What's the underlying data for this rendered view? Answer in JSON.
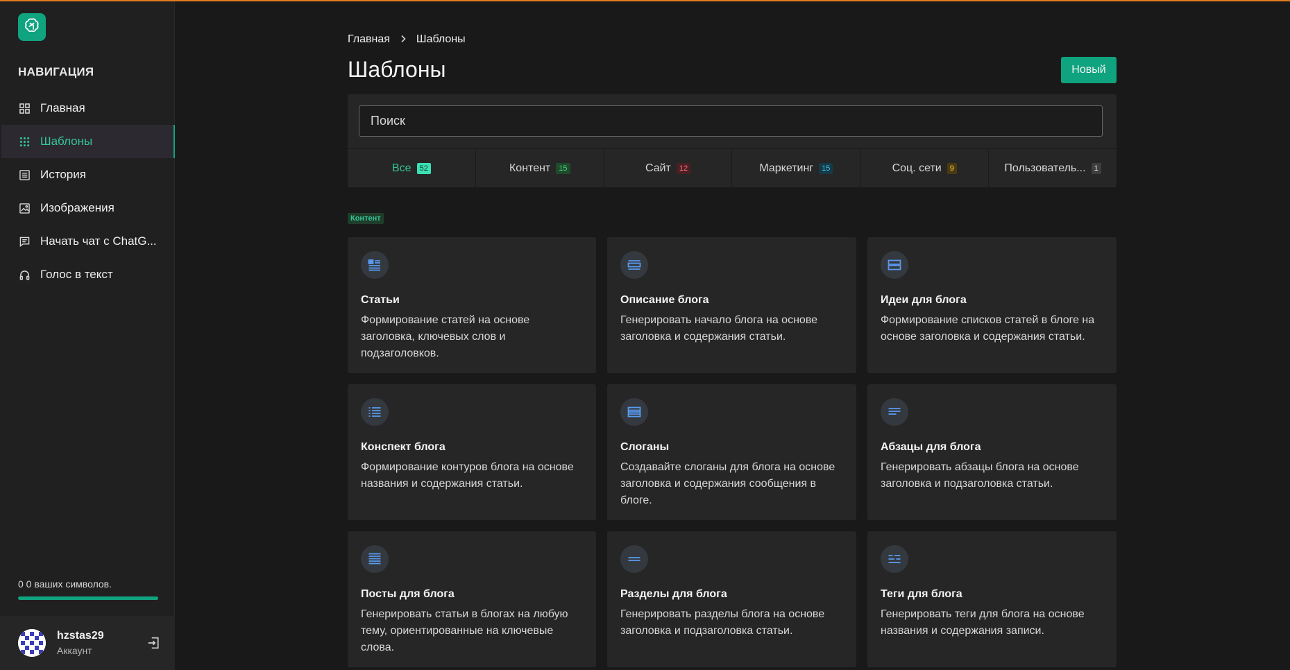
{
  "sidebar": {
    "nav_title": "НАВИГАЦИЯ",
    "items": [
      {
        "label": "Главная",
        "icon": "grid-icon"
      },
      {
        "label": "Шаблоны",
        "icon": "dots-grid-icon"
      },
      {
        "label": "История",
        "icon": "list-icon"
      },
      {
        "label": "Изображения",
        "icon": "image-icon"
      },
      {
        "label": "Начать чат с ChatG...",
        "icon": "chat-icon"
      },
      {
        "label": "Голос в текст",
        "icon": "headphones-icon"
      }
    ],
    "active_index": 1,
    "credits_text": "0 0 ваших символов.",
    "credits_fraction": 1.0,
    "user": {
      "name": "hzstas29",
      "sub": "Аккаунт"
    }
  },
  "header": {
    "breadcrumb": [
      "Главная",
      "Шаблоны"
    ],
    "title": "Шаблоны",
    "new_button": "Новый"
  },
  "search": {
    "placeholder": "Поиск",
    "value": ""
  },
  "tabs": [
    {
      "label": "Все",
      "count": "52",
      "badge_bg": "#3be0b3",
      "badge_fg": "#0e3b2e"
    },
    {
      "label": "Контент",
      "count": "15",
      "badge_bg": "#1f4a2c",
      "badge_fg": "#4fd37a"
    },
    {
      "label": "Сайт",
      "count": "12",
      "badge_bg": "#4a1f24",
      "badge_fg": "#ff6b74"
    },
    {
      "label": "Маркетинг",
      "count": "15",
      "badge_bg": "#163947",
      "badge_fg": "#3fc6e8"
    },
    {
      "label": "Соц. сети",
      "count": "9",
      "badge_bg": "#4a3a10",
      "badge_fg": "#f2c94c"
    },
    {
      "label": "Пользователь...",
      "count": "1",
      "badge_bg": "#3e3e3e",
      "badge_fg": "#e0e0e0"
    }
  ],
  "active_tab": 0,
  "section_label": "Контент",
  "cards": [
    {
      "title": "Статьи",
      "desc": "Формирование статей на основе заголовка, ключевых слов и подзаголовков.",
      "icon": "article-icon"
    },
    {
      "title": "Описание блога",
      "desc": "Генерировать начало блога на основе заголовка и содержания статьи.",
      "icon": "blog-description-icon"
    },
    {
      "title": "Идеи для блога",
      "desc": "Формирование списков статей в блоге на основе заголовка и содержания статьи.",
      "icon": "blog-ideas-icon"
    },
    {
      "title": "Конспект блога",
      "desc": "Формирование контуров блога на основе названия и содержания статьи.",
      "icon": "bullet-list-icon"
    },
    {
      "title": "Слоганы",
      "desc": "Создавайте слоганы для блога на основе заголовка и содержания сообщения в блоге.",
      "icon": "slogans-icon"
    },
    {
      "title": "Абзацы для блога",
      "desc": "Генерировать абзацы блога на основе заголовка и подзаголовка статьи.",
      "icon": "paragraph-icon"
    },
    {
      "title": "Посты для блога",
      "desc": "Генерировать статьи в блогах на любую тему, ориентированные на ключевые слова.",
      "icon": "posts-icon"
    },
    {
      "title": "Разделы для блога",
      "desc": "Генерировать разделы блога на основе заголовка и подзаголовка статьи.",
      "icon": "sections-icon"
    },
    {
      "title": "Теги для блога",
      "desc": "Генерировать теги для блога на основе названия и содержания записи.",
      "icon": "tags-icon"
    }
  ],
  "colors": {
    "accent": "#10a37f",
    "accent_text": "#34c59a",
    "card_icon": "#5b9bef",
    "top_line": "#e07b1f"
  }
}
